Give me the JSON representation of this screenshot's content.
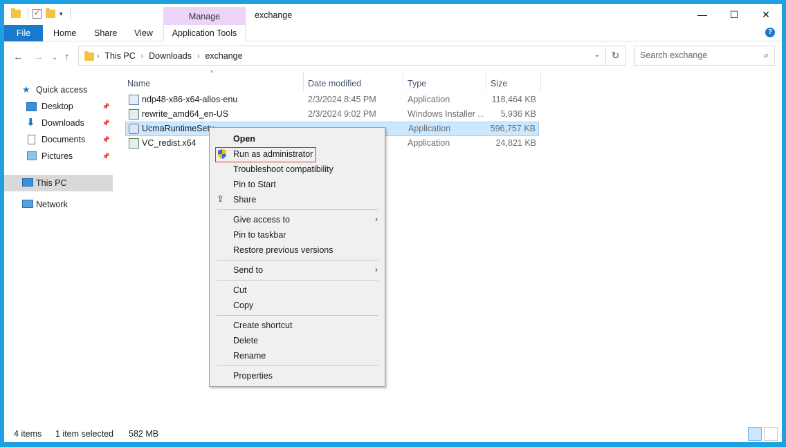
{
  "window": {
    "title": "exchange",
    "contextual_tab_group": "Manage",
    "caption": {
      "minimize": "—",
      "maximize": "☐",
      "close": "✕"
    }
  },
  "ribbon": {
    "tabs": [
      {
        "label": "File"
      },
      {
        "label": "Home"
      },
      {
        "label": "Share"
      },
      {
        "label": "View"
      },
      {
        "label": "Application Tools"
      }
    ]
  },
  "address": {
    "crumbs": [
      "This PC",
      "Downloads",
      "exchange"
    ],
    "search_placeholder": "Search exchange"
  },
  "nav": {
    "items": [
      {
        "label": "Quick access",
        "icon": "star-icon"
      },
      {
        "label": "Desktop",
        "icon": "desktop-icon",
        "pinned": true
      },
      {
        "label": "Downloads",
        "icon": "download-icon",
        "pinned": true
      },
      {
        "label": "Documents",
        "icon": "documents-icon",
        "pinned": true
      },
      {
        "label": "Pictures",
        "icon": "pictures-icon",
        "pinned": true
      },
      {
        "label": "This PC",
        "icon": "computer-icon",
        "selected": true
      },
      {
        "label": "Network",
        "icon": "network-icon"
      }
    ]
  },
  "columns": {
    "name": "Name",
    "date": "Date modified",
    "type": "Type",
    "size": "Size"
  },
  "files": [
    {
      "name": "ndp48-x86-x64-allos-enu",
      "date": "2/3/2024 8:45 PM",
      "type": "Application",
      "size": "118,464 KB"
    },
    {
      "name": "rewrite_amd64_en-US",
      "date": "2/3/2024 9:02 PM",
      "type": "Windows Installer ...",
      "size": "5,936 KB"
    },
    {
      "name": "UcmaRuntimeSetu",
      "date": "",
      "type": "Application",
      "size": "596,757 KB",
      "selected": true
    },
    {
      "name": "VC_redist.x64",
      "date": "",
      "type": "Application",
      "size": "24,821 KB"
    }
  ],
  "status": {
    "count": "4 items",
    "selection": "1 item selected",
    "size": "582 MB"
  },
  "context_menu": {
    "open": "Open",
    "run_as_admin": "Run as administrator",
    "troubleshoot": "Troubleshoot compatibility",
    "pin_start": "Pin to Start",
    "share": "Share",
    "give_access": "Give access to",
    "pin_taskbar": "Pin to taskbar",
    "restore": "Restore previous versions",
    "send_to": "Send to",
    "cut": "Cut",
    "copy": "Copy",
    "create_shortcut": "Create shortcut",
    "delete": "Delete",
    "rename": "Rename",
    "properties": "Properties"
  }
}
